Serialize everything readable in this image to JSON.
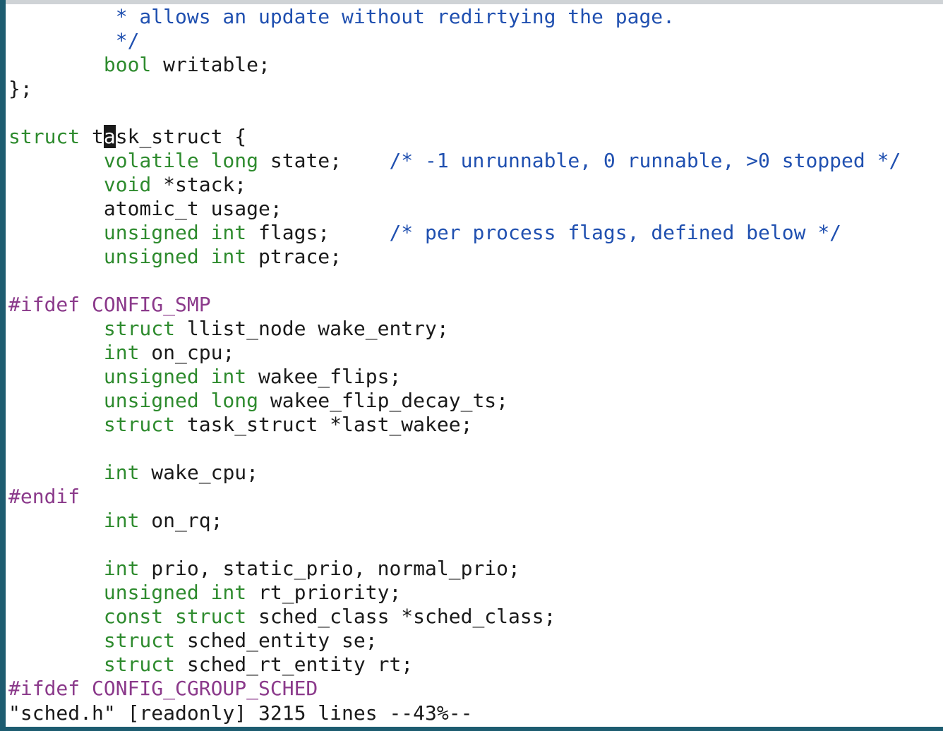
{
  "colors": {
    "keyword": "#2e8b2e",
    "comment": "#2050b0",
    "preprocessor": "#8b3a8b",
    "text": "#1a1a1a",
    "background": "#ffffff"
  },
  "code_lines": [
    [
      {
        "t": "         * allows an update without redirtying the page.",
        "c": "cm"
      }
    ],
    [
      {
        "t": "         */",
        "c": "cm"
      }
    ],
    [
      {
        "t": "        "
      },
      {
        "t": "bool",
        "c": "kw"
      },
      {
        "t": " writable;"
      }
    ],
    [
      {
        "t": "};"
      }
    ],
    [
      {
        "t": ""
      }
    ],
    [
      {
        "t": "struct",
        "c": "kw"
      },
      {
        "t": " t"
      },
      {
        "t": "a",
        "c": "cur"
      },
      {
        "t": "sk_struct {"
      }
    ],
    [
      {
        "t": "        "
      },
      {
        "t": "volatile long",
        "c": "kw"
      },
      {
        "t": " state;    "
      },
      {
        "t": "/* -1 unrunnable, 0 runnable, >0 stopped */",
        "c": "cm"
      }
    ],
    [
      {
        "t": "        "
      },
      {
        "t": "void",
        "c": "kw"
      },
      {
        "t": " *stack;"
      }
    ],
    [
      {
        "t": "        atomic_t usage;"
      }
    ],
    [
      {
        "t": "        "
      },
      {
        "t": "unsigned int",
        "c": "kw"
      },
      {
        "t": " flags;     "
      },
      {
        "t": "/* per process flags, defined below */",
        "c": "cm"
      }
    ],
    [
      {
        "t": "        "
      },
      {
        "t": "unsigned int",
        "c": "kw"
      },
      {
        "t": " ptrace;"
      }
    ],
    [
      {
        "t": ""
      }
    ],
    [
      {
        "t": "#ifdef CONFIG_SMP",
        "c": "pp"
      }
    ],
    [
      {
        "t": "        "
      },
      {
        "t": "struct",
        "c": "kw"
      },
      {
        "t": " llist_node wake_entry;"
      }
    ],
    [
      {
        "t": "        "
      },
      {
        "t": "int",
        "c": "kw"
      },
      {
        "t": " on_cpu;"
      }
    ],
    [
      {
        "t": "        "
      },
      {
        "t": "unsigned int",
        "c": "kw"
      },
      {
        "t": " wakee_flips;"
      }
    ],
    [
      {
        "t": "        "
      },
      {
        "t": "unsigned long",
        "c": "kw"
      },
      {
        "t": " wakee_flip_decay_ts;"
      }
    ],
    [
      {
        "t": "        "
      },
      {
        "t": "struct",
        "c": "kw"
      },
      {
        "t": " task_struct *last_wakee;"
      }
    ],
    [
      {
        "t": ""
      }
    ],
    [
      {
        "t": "        "
      },
      {
        "t": "int",
        "c": "kw"
      },
      {
        "t": " wake_cpu;"
      }
    ],
    [
      {
        "t": "#endif",
        "c": "pp"
      }
    ],
    [
      {
        "t": "        "
      },
      {
        "t": "int",
        "c": "kw"
      },
      {
        "t": " on_rq;"
      }
    ],
    [
      {
        "t": ""
      }
    ],
    [
      {
        "t": "        "
      },
      {
        "t": "int",
        "c": "kw"
      },
      {
        "t": " prio, static_prio, normal_prio;"
      }
    ],
    [
      {
        "t": "        "
      },
      {
        "t": "unsigned int",
        "c": "kw"
      },
      {
        "t": " rt_priority;"
      }
    ],
    [
      {
        "t": "        "
      },
      {
        "t": "const struct",
        "c": "kw"
      },
      {
        "t": " sched_class *sched_class;"
      }
    ],
    [
      {
        "t": "        "
      },
      {
        "t": "struct",
        "c": "kw"
      },
      {
        "t": " sched_entity se;"
      }
    ],
    [
      {
        "t": "        "
      },
      {
        "t": "struct",
        "c": "kw"
      },
      {
        "t": " sched_rt_entity rt;"
      }
    ],
    [
      {
        "t": "#ifdef CONFIG_CGROUP_SCHED",
        "c": "pp"
      }
    ]
  ],
  "status_line": "\"sched.h\" [readonly] 3215 lines --43%--"
}
